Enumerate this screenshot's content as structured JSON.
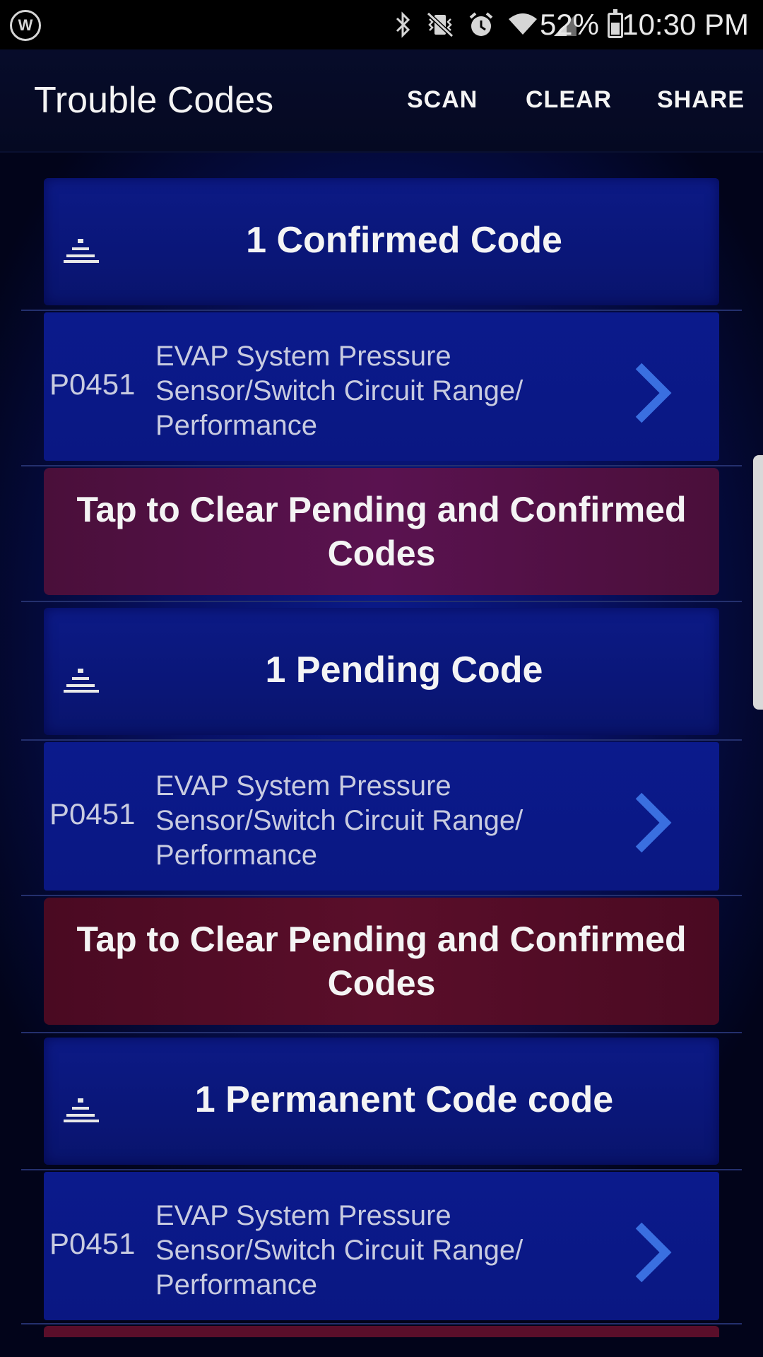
{
  "status_bar": {
    "battery_percent": "52%",
    "time": "10:30 PM",
    "app_icon_letter": "W",
    "icons": [
      "bluetooth-icon",
      "vibrate-mute-icon",
      "alarm-icon",
      "wifi-icon",
      "signal-icon",
      "battery-icon"
    ]
  },
  "appbar": {
    "title": "Trouble Codes",
    "actions": {
      "scan": "SCAN",
      "clear": "CLEAR",
      "share": "SHARE"
    }
  },
  "sections": [
    {
      "header": "1 Confirmed Code",
      "codes": [
        {
          "code": "P0451",
          "description": "EVAP System Pressure Sensor/Switch Circuit Range/ Performance"
        }
      ],
      "clear_label": "Tap to Clear Pending and Confirmed Codes"
    },
    {
      "header": "1 Pending Code",
      "codes": [
        {
          "code": "P0451",
          "description": "EVAP System Pressure Sensor/Switch Circuit Range/ Performance"
        }
      ],
      "clear_label": "Tap to Clear Pending and Confirmed Codes"
    },
    {
      "header": "1 Permanent Code code",
      "codes": [
        {
          "code": "P0451",
          "description": "EVAP System Pressure Sensor/Switch Circuit Range/ Performance"
        }
      ]
    }
  ],
  "colors": {
    "appbar_bg": "#070c2a",
    "section_bg": "#0a1678",
    "clear_confirmed_bg": "#5a1250",
    "clear_pending_bg": "#5a0e2a",
    "chevron": "#3a6fe0"
  }
}
